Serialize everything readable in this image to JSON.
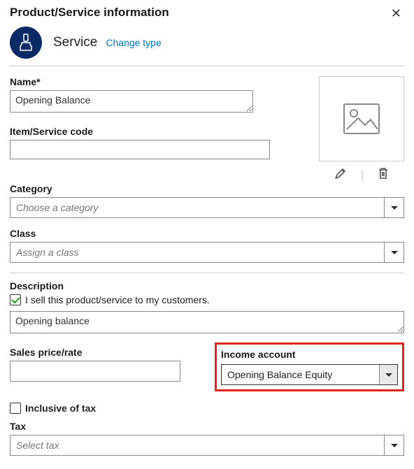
{
  "header": {
    "title": "Product/Service information"
  },
  "type": {
    "label": "Service",
    "change_link": "Change type"
  },
  "name": {
    "label": "Name*",
    "value": "Opening Balance"
  },
  "code": {
    "label": "Item/Service code",
    "value": ""
  },
  "category": {
    "label": "Category",
    "placeholder": "Choose a category"
  },
  "class": {
    "label": "Class",
    "placeholder": "Assign a class"
  },
  "description": {
    "label": "Description",
    "checkbox_label": "I sell this product/service to my customers.",
    "value": "Opening balance"
  },
  "price": {
    "label": "Sales price/rate",
    "value": ""
  },
  "income_account": {
    "label": "Income account",
    "value": "Opening Balance Equity"
  },
  "inclusive": {
    "label": "Inclusive of tax"
  },
  "tax": {
    "label": "Tax",
    "placeholder": "Select tax"
  }
}
